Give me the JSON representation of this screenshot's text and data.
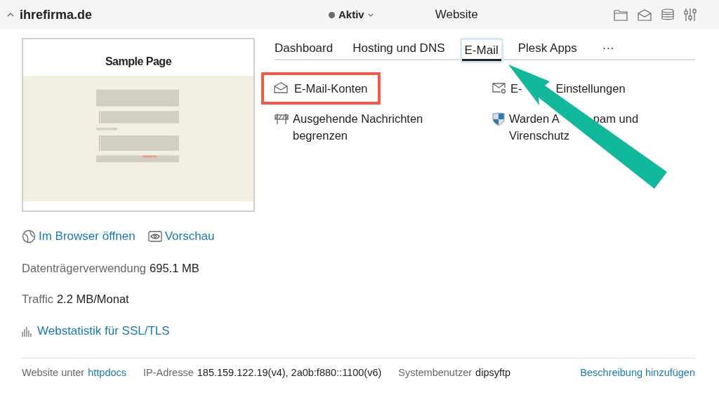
{
  "header": {
    "expanded": true,
    "domain": "ihrefirma.de",
    "status": {
      "label": "Aktiv",
      "color": "#6b6b6b"
    },
    "section": "Website"
  },
  "preview": {
    "heading": "Sample Page"
  },
  "tabs": [
    {
      "label": "Dashboard",
      "selected": false
    },
    {
      "label": "Hosting und DNS",
      "selected": false
    },
    {
      "label": "E-Mail",
      "selected": true
    },
    {
      "label": "Plesk Apps",
      "selected": false
    }
  ],
  "more_tabs": "···",
  "tools": [
    {
      "kind": "mailbox",
      "lines": [
        [
          "E-Mail-Konten"
        ]
      ],
      "highlighted": true
    },
    {
      "kind": "settings",
      "lines": [
        [
          "E-",
          "Einstellungen"
        ]
      ],
      "highlighted": false
    },
    {
      "kind": "limit",
      "lines": [
        [
          "Ausgehende Nachrichten"
        ],
        [
          "begrenzen"
        ]
      ],
      "highlighted": false
    },
    {
      "kind": "shield",
      "lines": [
        [
          "Warden A",
          "pam und"
        ],
        [
          "Virenschutz"
        ]
      ],
      "highlighted": false
    }
  ],
  "site_links": [
    {
      "kind": "globe",
      "label": "Im Browser öffnen"
    },
    {
      "kind": "eye",
      "label": "Vorschau"
    }
  ],
  "stats": [
    {
      "label": "Datenträgerverwendung",
      "value": "695.1 MB"
    },
    {
      "label": "Traffic",
      "value": "2.2 MB/Monat"
    }
  ],
  "stats_link": "Webstatistik für SSL/TLS",
  "footer": {
    "docroot_label": "Website unter",
    "docroot": "httpdocs",
    "ip_label": "IP-Adresse",
    "ip": "185.159.122.19(v4), 2a0b:f880::1100(v6)",
    "user_label": "Systembenutzer",
    "user": "dipsyftp",
    "action": "Beschreibung hinzufügen"
  }
}
